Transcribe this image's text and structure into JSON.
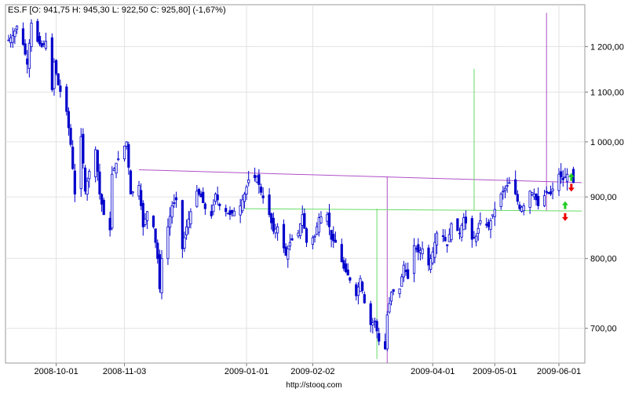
{
  "chart_data": {
    "type": "candlestick",
    "symbol_line": "ES.F [O: 941,75  H: 945,30  L: 922,50  C: 925,80] (-1,67%)",
    "source": "http://stooq.com",
    "scale": "log",
    "ylim": [
      655,
      1300
    ],
    "xlim": [
      "2008-09-08",
      "2009-06-12"
    ],
    "y_ticks": [
      {
        "value": 700,
        "label": "700,00"
      },
      {
        "value": 800,
        "label": "800,00"
      },
      {
        "value": 900,
        "label": "900,00"
      },
      {
        "value": 1000,
        "label": "1 000,00"
      },
      {
        "value": 1100,
        "label": "1 100,00"
      },
      {
        "value": 1200,
        "label": "1 200,00"
      }
    ],
    "x_ticks": [
      {
        "date": "2008-10-01",
        "label": "2008-10-01"
      },
      {
        "date": "2008-11-03",
        "label": "2008-11-03"
      },
      {
        "date": "2009-01-01",
        "label": "2009-01-01"
      },
      {
        "date": "2009-02-02",
        "label": "2009-02-02"
      },
      {
        "date": "2009-04-01",
        "label": "2009-04-01"
      },
      {
        "date": "2009-05-01",
        "label": "2009-05-01"
      },
      {
        "date": "2009-06-01",
        "label": "2009-06-01"
      }
    ],
    "grid": true,
    "series_color": "#0000cc",
    "annotation_lines": [
      {
        "color": "#b050c8",
        "points": [
          [
            "2008-11-10",
            948
          ],
          [
            "2009-06-12",
            925
          ]
        ]
      },
      {
        "color": "#b050c8",
        "points": [
          [
            "2009-03-10",
            655
          ],
          [
            "2009-03-10",
            936
          ]
        ]
      },
      {
        "color": "#b050c8",
        "points": [
          [
            "2009-05-26",
            876
          ],
          [
            "2009-05-26",
            1280
          ]
        ]
      },
      {
        "color": "#66dd66",
        "points": [
          [
            "2008-12-31",
            880
          ],
          [
            "2009-06-12",
            876
          ]
        ]
      },
      {
        "color": "#66dd66",
        "points": [
          [
            "2009-03-05",
            660
          ],
          [
            "2009-03-05",
            880
          ]
        ]
      },
      {
        "color": "#66dd66",
        "points": [
          [
            "2009-04-21",
            878
          ],
          [
            "2009-04-21",
            1150
          ]
        ]
      }
    ],
    "markers": [
      {
        "type": "up",
        "color": "#22cc22",
        "date": "2009-06-07",
        "value": 935
      },
      {
        "type": "down",
        "color": "#ee0000",
        "date": "2009-06-07",
        "value": 916
      },
      {
        "type": "up",
        "color": "#22cc22",
        "date": "2009-06-04",
        "value": 886
      },
      {
        "type": "down",
        "color": "#ee0000",
        "date": "2009-06-04",
        "value": 866
      }
    ],
    "keypoints": [
      [
        "2008-09-08",
        1215
      ],
      [
        "2008-09-10",
        1225
      ],
      [
        "2008-09-12",
        1248
      ],
      [
        "2008-09-15",
        1205
      ],
      [
        "2008-09-17",
        1160
      ],
      [
        "2008-09-19",
        1255
      ],
      [
        "2008-09-22",
        1212
      ],
      [
        "2008-09-24",
        1200
      ],
      [
        "2008-09-26",
        1212
      ],
      [
        "2008-09-29",
        1105
      ],
      [
        "2008-09-30",
        1165
      ],
      [
        "2008-10-02",
        1115
      ],
      [
        "2008-10-06",
        1060
      ],
      [
        "2008-10-08",
        995
      ],
      [
        "2008-10-10",
        905
      ],
      [
        "2008-10-13",
        1010
      ],
      [
        "2008-10-15",
        910
      ],
      [
        "2008-10-17",
        945
      ],
      [
        "2008-10-20",
        985
      ],
      [
        "2008-10-22",
        905
      ],
      [
        "2008-10-24",
        870
      ],
      [
        "2008-10-27",
        845
      ],
      [
        "2008-10-28",
        940
      ],
      [
        "2008-10-30",
        960
      ],
      [
        "2008-11-04",
        1000
      ],
      [
        "2008-11-06",
        905
      ],
      [
        "2008-11-10",
        920
      ],
      [
        "2008-11-12",
        850
      ],
      [
        "2008-11-14",
        875
      ],
      [
        "2008-11-17",
        850
      ],
      [
        "2008-11-19",
        800
      ],
      [
        "2008-11-20",
        755
      ],
      [
        "2008-11-21",
        800
      ],
      [
        "2008-11-24",
        850
      ],
      [
        "2008-11-26",
        885
      ],
      [
        "2008-11-28",
        895
      ],
      [
        "2008-12-01",
        815
      ],
      [
        "2008-12-03",
        850
      ],
      [
        "2008-12-05",
        875
      ],
      [
        "2008-12-08",
        910
      ],
      [
        "2008-12-10",
        900
      ],
      [
        "2008-12-12",
        880
      ],
      [
        "2008-12-15",
        868
      ],
      [
        "2008-12-17",
        905
      ],
      [
        "2008-12-19",
        885
      ],
      [
        "2008-12-22",
        875
      ],
      [
        "2008-12-24",
        870
      ],
      [
        "2008-12-29",
        885
      ],
      [
        "2008-12-31",
        905
      ],
      [
        "2009-01-02",
        930
      ],
      [
        "2009-01-06",
        935
      ],
      [
        "2009-01-08",
        908
      ],
      [
        "2009-01-12",
        870
      ],
      [
        "2009-01-14",
        843
      ],
      [
        "2009-01-16",
        850
      ],
      [
        "2009-01-20",
        805
      ],
      [
        "2009-01-22",
        825
      ],
      [
        "2009-01-26",
        840
      ],
      [
        "2009-01-28",
        870
      ],
      [
        "2009-01-30",
        825
      ],
      [
        "2009-02-03",
        835
      ],
      [
        "2009-02-05",
        865
      ],
      [
        "2009-02-09",
        870
      ],
      [
        "2009-02-11",
        830
      ],
      [
        "2009-02-13",
        825
      ],
      [
        "2009-02-17",
        785
      ],
      [
        "2009-02-19",
        775
      ],
      [
        "2009-02-23",
        745
      ],
      [
        "2009-02-25",
        770
      ],
      [
        "2009-02-27",
        735
      ],
      [
        "2009-03-02",
        705
      ],
      [
        "2009-03-04",
        710
      ],
      [
        "2009-03-06",
        683
      ],
      [
        "2009-03-09",
        673
      ],
      [
        "2009-03-10",
        718
      ],
      [
        "2009-03-12",
        750
      ],
      [
        "2009-03-16",
        755
      ],
      [
        "2009-03-18",
        790
      ],
      [
        "2009-03-20",
        770
      ],
      [
        "2009-03-23",
        820
      ],
      [
        "2009-03-25",
        810
      ],
      [
        "2009-03-27",
        815
      ],
      [
        "2009-03-30",
        790
      ],
      [
        "2009-04-01",
        810
      ],
      [
        "2009-04-03",
        840
      ],
      [
        "2009-04-06",
        835
      ],
      [
        "2009-04-08",
        820
      ],
      [
        "2009-04-10",
        855
      ],
      [
        "2009-04-14",
        840
      ],
      [
        "2009-04-16",
        865
      ],
      [
        "2009-04-20",
        830
      ],
      [
        "2009-04-22",
        835
      ],
      [
        "2009-04-24",
        860
      ],
      [
        "2009-04-28",
        850
      ],
      [
        "2009-04-30",
        870
      ],
      [
        "2009-05-04",
        905
      ],
      [
        "2009-05-06",
        915
      ],
      [
        "2009-05-08",
        925
      ],
      [
        "2009-05-11",
        905
      ],
      [
        "2009-05-13",
        880
      ],
      [
        "2009-05-15",
        885
      ],
      [
        "2009-05-18",
        910
      ],
      [
        "2009-05-20",
        905
      ],
      [
        "2009-05-22",
        885
      ],
      [
        "2009-05-26",
        908
      ],
      [
        "2009-05-28",
        905
      ],
      [
        "2009-06-01",
        940
      ],
      [
        "2009-06-03",
        930
      ],
      [
        "2009-06-05",
        940
      ],
      [
        "2009-06-08",
        925
      ]
    ]
  }
}
